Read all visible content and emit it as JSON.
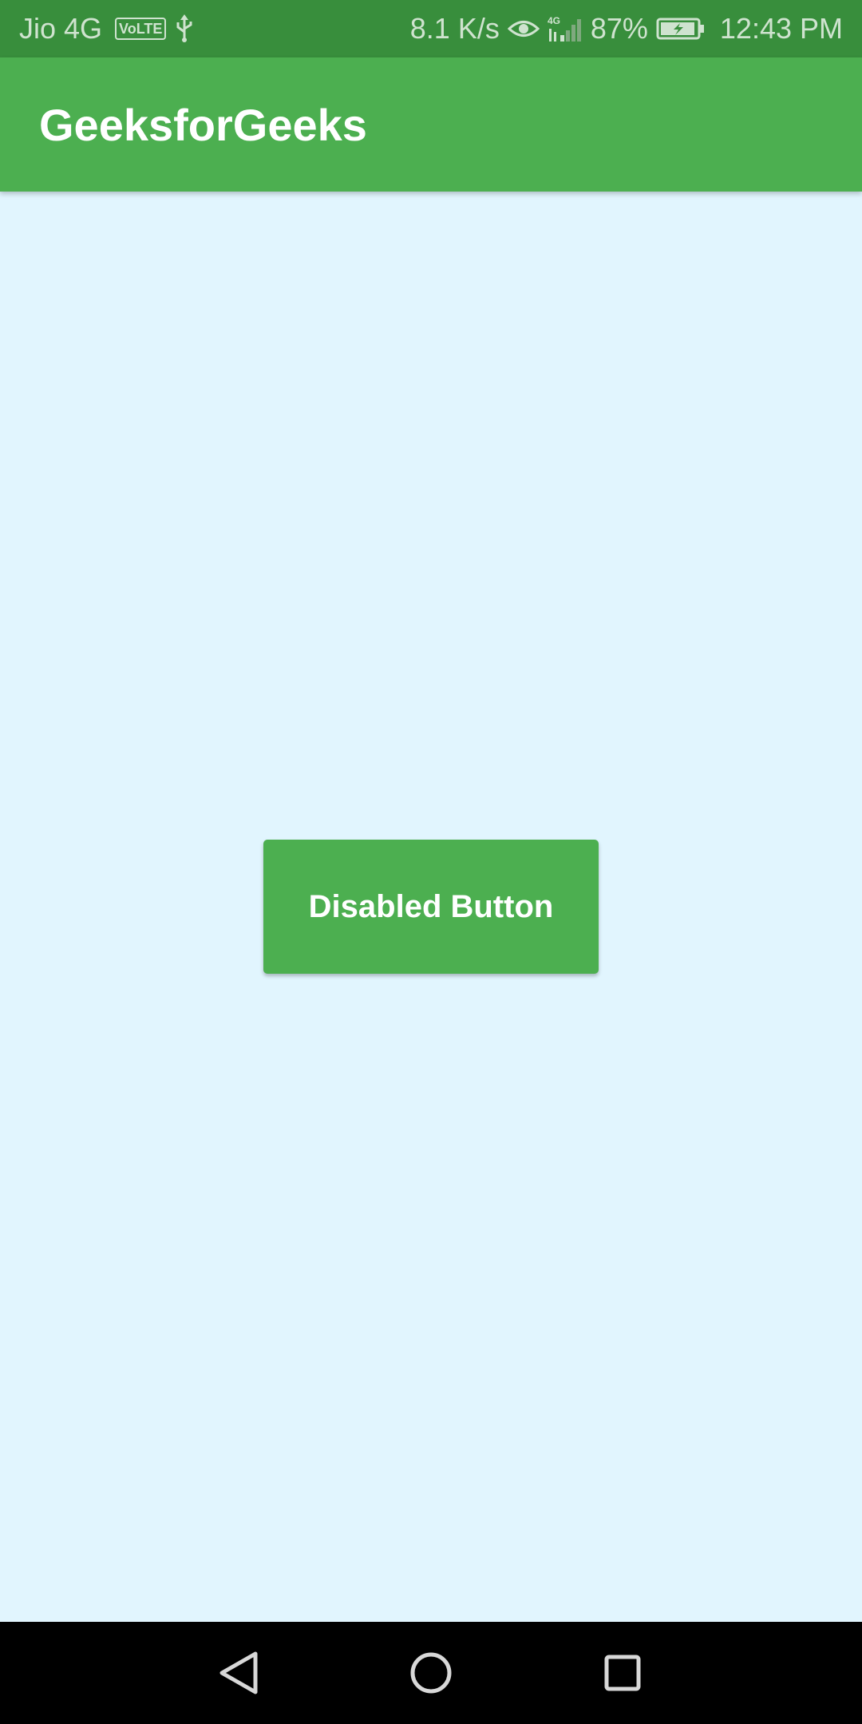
{
  "status_bar": {
    "carrier": "Jio 4G",
    "volte": "VoLTE",
    "network_speed": "8.1 K/s",
    "network_type": "4G",
    "battery": "87%",
    "time": "12:43 PM",
    "icons": [
      "usb-icon",
      "eye-icon",
      "signal-icon",
      "battery-charging-icon"
    ]
  },
  "app_bar": {
    "title": "GeeksforGeeks",
    "color": "#4CAF50"
  },
  "content": {
    "background": "#E1F5FE",
    "button": {
      "label": "Disabled Button",
      "color": "#4CAF50"
    }
  },
  "nav_bar": {
    "icons": [
      "back-icon",
      "home-icon",
      "recents-icon"
    ]
  }
}
